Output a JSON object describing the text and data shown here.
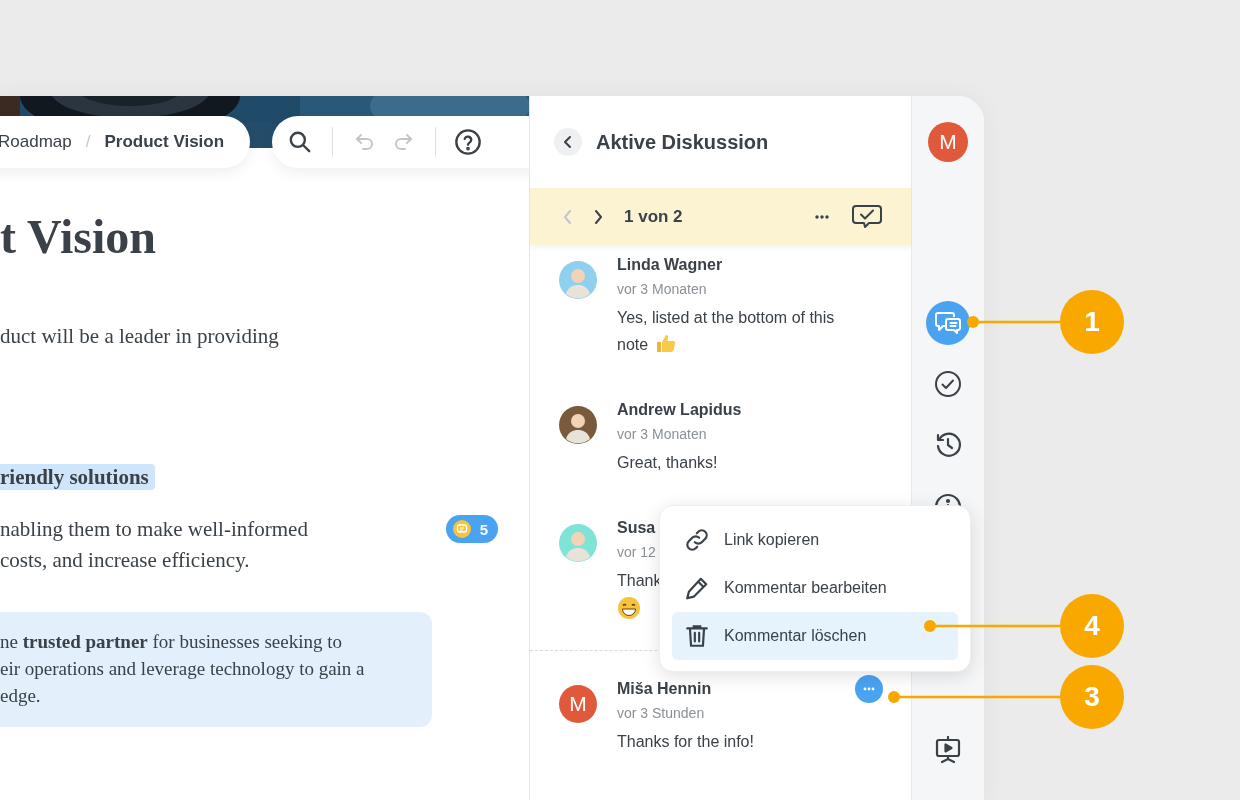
{
  "document": {
    "breadcrumb": [
      {
        "label": "Roadmap",
        "current": false
      },
      {
        "label": "Product Vision",
        "current": true
      }
    ],
    "breadcrumb_separator": "/",
    "toolbar": [
      {
        "kind": "search",
        "disabled": false
      },
      {
        "kind": "undo",
        "disabled": true
      },
      {
        "kind": "redo",
        "disabled": true
      },
      {
        "kind": "help",
        "disabled": false
      }
    ],
    "title": "t Vision",
    "intro": "duct will be a leader in providing",
    "highlight": "riendly solutions",
    "body_lines": [
      "nabling them to make well-informed",
      "costs, and increase efficiency."
    ],
    "comment_count": "5",
    "callout_lines": [
      "ne **trusted partner** for businesses seeking to",
      "eir operations and leverage technology to gain a",
      "edge."
    ]
  },
  "discussion": {
    "title": "Aktive Diskussion",
    "pager": {
      "label": "1 von 2",
      "prev_disabled": true,
      "next_disabled": false
    },
    "comments": [
      {
        "name": "Linda Wagner",
        "time": "vor 3 Monaten",
        "text": "Yes, listed at the bottom of this note",
        "avatar": {
          "kind": "figure",
          "color": "#8fd0ee"
        },
        "kind": "thumb-inline",
        "menu_open": false
      },
      {
        "name": "Andrew Lapidus",
        "time": "vor 3 Monaten",
        "text": "Great, thanks!",
        "avatar": {
          "kind": "figure",
          "color": "#7a5a3c"
        },
        "kind": "plain",
        "menu_open": false
      },
      {
        "name": "Susa",
        "time": "vor 12",
        "text": "Thank",
        "avatar": {
          "kind": "figure",
          "color": "#7fe3d6"
        },
        "kind": "grin-below",
        "menu_open": false
      },
      {
        "name": "Miša Hennin",
        "time": "vor 3 Stunden",
        "text": "Thanks for the info!",
        "avatar": {
          "kind": "letter",
          "initial": "M",
          "color": "#e0593a"
        },
        "kind": "plain",
        "menu_open": true
      }
    ]
  },
  "menu": [
    {
      "kind": "link",
      "label": "Link kopieren",
      "selected": false
    },
    {
      "kind": "edit",
      "label": "Kommentar bearbeiten",
      "selected": false
    },
    {
      "kind": "delete",
      "label": "Kommentar löschen",
      "selected": true
    }
  ],
  "rail": {
    "user_initial": "M",
    "items": [
      {
        "kind": "comments",
        "selected": true
      },
      {
        "kind": "tasks",
        "selected": false
      },
      {
        "kind": "history",
        "selected": false
      },
      {
        "kind": "info",
        "selected": false
      },
      {
        "kind": "presentation",
        "selected": false
      }
    ]
  },
  "callouts": [
    {
      "label": "1"
    },
    {
      "label": "4"
    },
    {
      "label": "3"
    }
  ]
}
